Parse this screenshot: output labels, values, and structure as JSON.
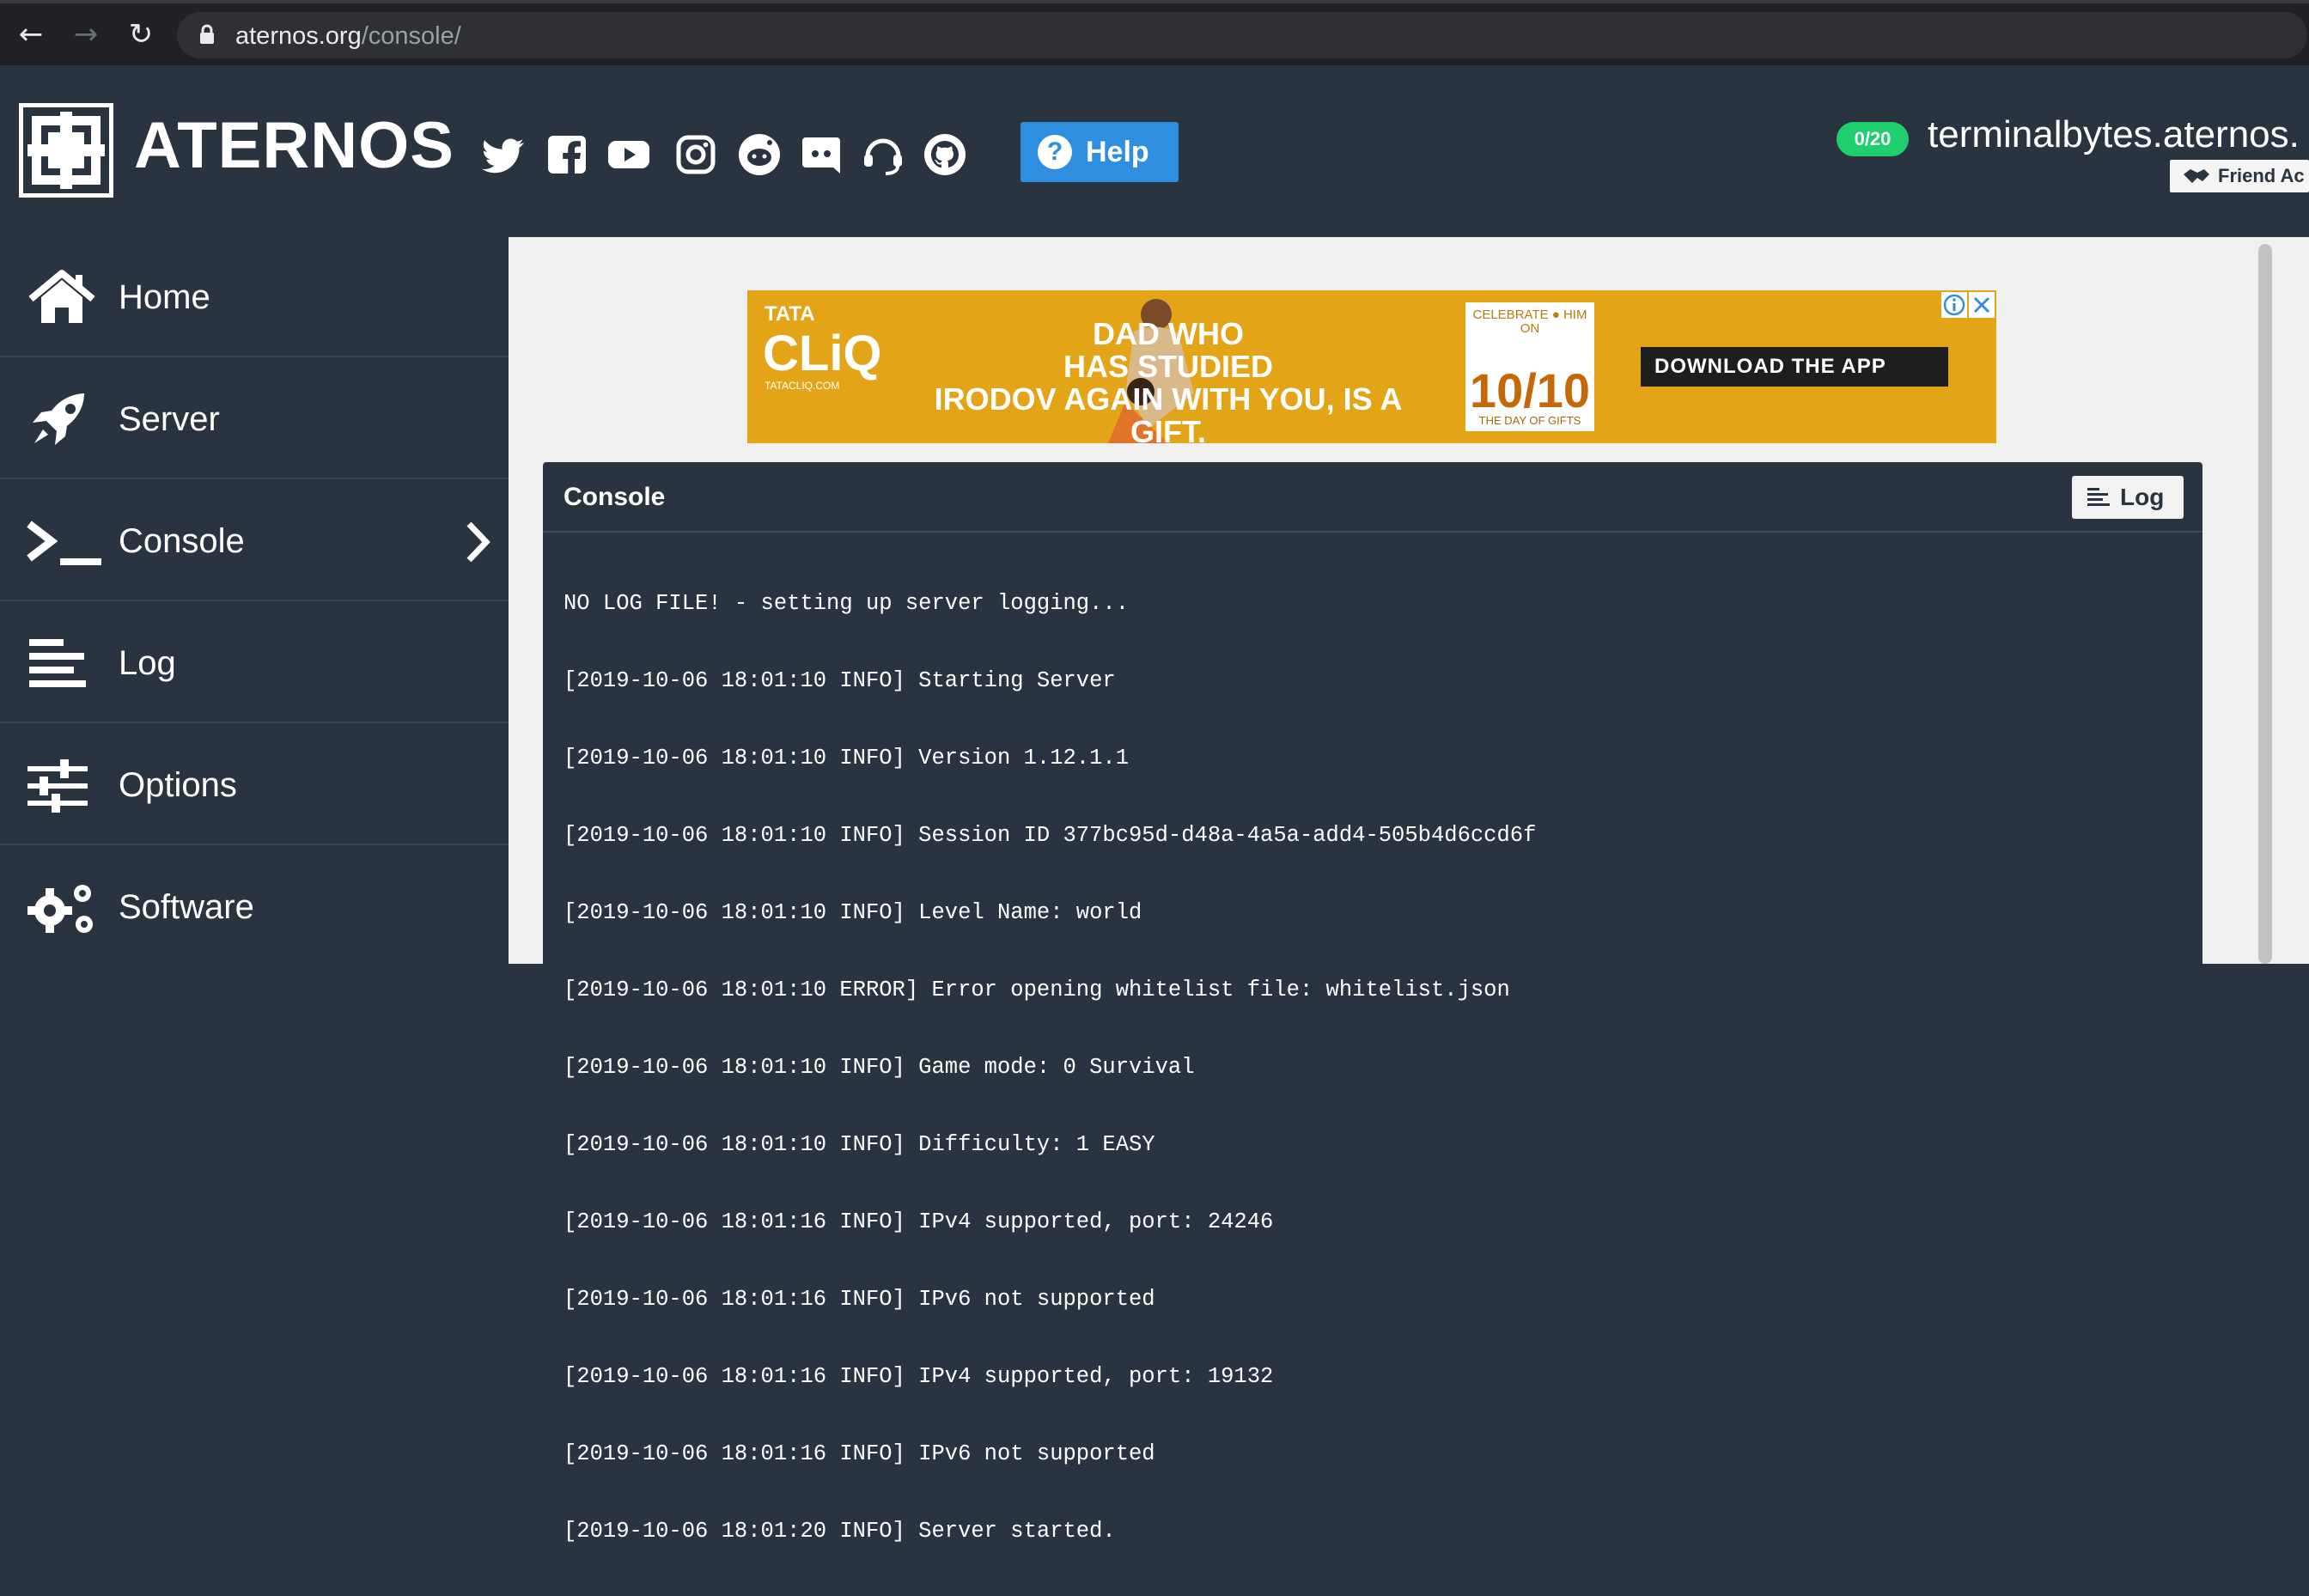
{
  "browser": {
    "url_host": "aternos.org",
    "url_path": "/console/"
  },
  "header": {
    "brand": "ATERNOS",
    "social_icons": [
      "twitter-icon",
      "facebook-icon",
      "youtube-icon",
      "instagram-icon",
      "reddit-icon",
      "discord-icon",
      "support-headset-icon",
      "github-icon"
    ],
    "help_label": "Help",
    "players_badge": "0/20",
    "server_address": "terminalbytes.aternos.",
    "friend_label": "Friend Ac"
  },
  "sidebar": {
    "items": [
      {
        "label": "Home",
        "icon": "home-icon"
      },
      {
        "label": "Server",
        "icon": "rocket-icon"
      },
      {
        "label": "Console",
        "icon": "terminal-icon",
        "active": true
      },
      {
        "label": "Log",
        "icon": "log-lines-icon"
      },
      {
        "label": "Options",
        "icon": "sliders-icon"
      },
      {
        "label": "Software",
        "icon": "gears-icon"
      }
    ]
  },
  "ad": {
    "brand_top": "TATA",
    "brand": "CLiQ",
    "brand_small": "TATACLIQ.COM",
    "tagline_1": "DAD WHO",
    "tagline_2": "HAS STUDIED",
    "tagline_3": "IRODOV AGAIN WITH YOU, IS A GIFT.",
    "card_1": "CELEBRATE ● HIM",
    "card_2": "ON",
    "card_3": "10/10",
    "card_4": "THE DAY OF GIFTS",
    "cta": "DOWNLOAD THE APP"
  },
  "console": {
    "title": "Console",
    "log_button": "Log",
    "lines": [
      "NO LOG FILE! - setting up server logging...",
      "[2019-10-06 18:01:10 INFO] Starting Server",
      "[2019-10-06 18:01:10 INFO] Version 1.12.1.1",
      "[2019-10-06 18:01:10 INFO] Session ID 377bc95d-d48a-4a5a-add4-505b4d6ccd6f",
      "[2019-10-06 18:01:10 INFO] Level Name: world",
      "[2019-10-06 18:01:10 ERROR] Error opening whitelist file: whitelist.json",
      "[2019-10-06 18:01:10 INFO] Game mode: 0 Survival",
      "[2019-10-06 18:01:10 INFO] Difficulty: 1 EASY",
      "[2019-10-06 18:01:16 INFO] IPv4 supported, port: 24246",
      "[2019-10-06 18:01:16 INFO] IPv6 not supported",
      "[2019-10-06 18:01:16 INFO] IPv4 supported, port: 19132",
      "[2019-10-06 18:01:16 INFO] IPv6 not supported",
      "[2019-10-06 18:01:20 INFO] Server started."
    ]
  },
  "colors": {
    "panel_bg": "#2a3440",
    "content_bg": "#f0f0f0",
    "help_blue": "#2e8fe0",
    "badge_green": "#1fcf6f",
    "ad_yellow": "#e3a417"
  }
}
